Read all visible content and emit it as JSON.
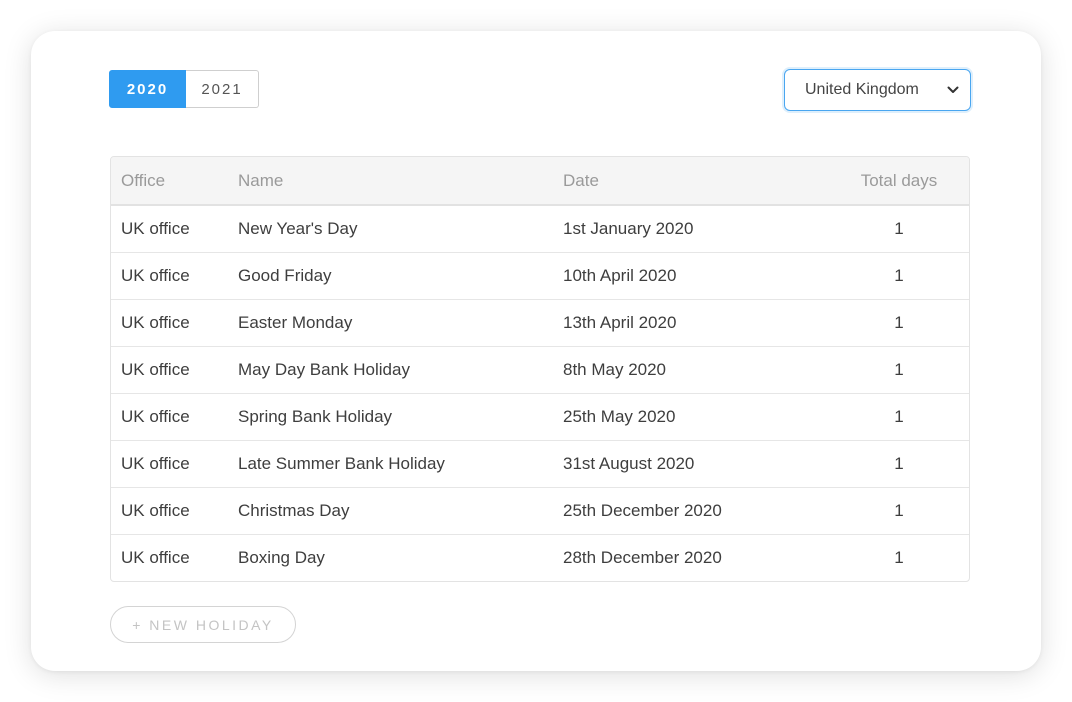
{
  "years": {
    "active": "2020",
    "other": "2021"
  },
  "country_select": {
    "value": "United Kingdom"
  },
  "table": {
    "headers": {
      "office": "Office",
      "name": "Name",
      "date": "Date",
      "total": "Total days"
    },
    "rows": [
      {
        "office": "UK office",
        "name": "New Year's Day",
        "date": "1st January 2020",
        "total": "1"
      },
      {
        "office": "UK office",
        "name": "Good Friday",
        "date": "10th April 2020",
        "total": "1"
      },
      {
        "office": "UK office",
        "name": "Easter Monday",
        "date": "13th April 2020",
        "total": "1"
      },
      {
        "office": "UK office",
        "name": "May Day Bank Holiday",
        "date": "8th May 2020",
        "total": "1"
      },
      {
        "office": "UK office",
        "name": "Spring Bank Holiday",
        "date": "25th May 2020",
        "total": "1"
      },
      {
        "office": "UK office",
        "name": "Late Summer Bank Holiday",
        "date": "31st August 2020",
        "total": "1"
      },
      {
        "office": "UK office",
        "name": "Christmas Day",
        "date": "25th December 2020",
        "total": "1"
      },
      {
        "office": "UK office",
        "name": "Boxing Day",
        "date": "28th December 2020",
        "total": "1"
      }
    ]
  },
  "new_holiday_label": "+ NEW HOLIDAY",
  "colors": {
    "accent": "#2f9bf0",
    "select_border": "#4aa6f0"
  }
}
